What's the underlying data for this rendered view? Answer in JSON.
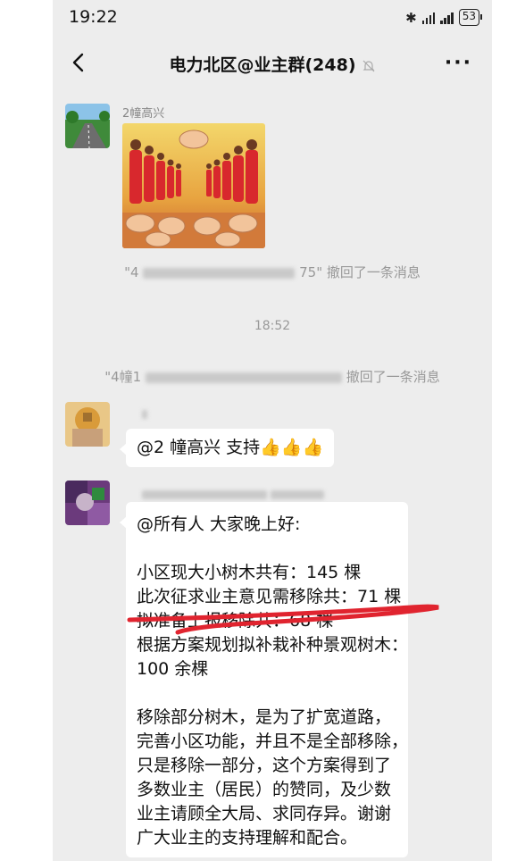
{
  "status_bar": {
    "time": "19:22",
    "battery": "53"
  },
  "header": {
    "back": "<",
    "title": "电力北区@业主群(248)",
    "more": "···"
  },
  "messages": [
    {
      "sender": "2幢高兴",
      "type": "image"
    },
    {
      "system_prefix": "\"4",
      "system_mid": "75\"",
      "system_suffix": "撤回了一条消息"
    },
    {
      "time": "18:52"
    },
    {
      "system_prefix": "\"4幢1",
      "system_suffix": "撤回了一条消息"
    },
    {
      "text": "@2 幢高兴  支持👍👍👍"
    },
    {
      "lines": [
        "@所有人  大家晚上好:",
        "",
        "小区现大小树木共有：145 棵",
        "此次征求业主意见需移除共：71 棵",
        "拟准备上报移除共：68 棵",
        "根据方案规划拟补栽补种景观树木：",
        "100 余棵",
        "",
        "移除部分树木，是为了扩宽道路，",
        "完善小区功能，并且不是全部移除，",
        "只是移除一部分，这个方案得到了",
        "多数业主（居民）的赞同，及少数",
        "业主请顾全大局、求同存异。谢谢",
        "广大业主的支持理解和配合。"
      ]
    }
  ],
  "colors": {
    "chat_bg": "#ededed",
    "bubble": "#ffffff",
    "underline": "#e0242f"
  }
}
